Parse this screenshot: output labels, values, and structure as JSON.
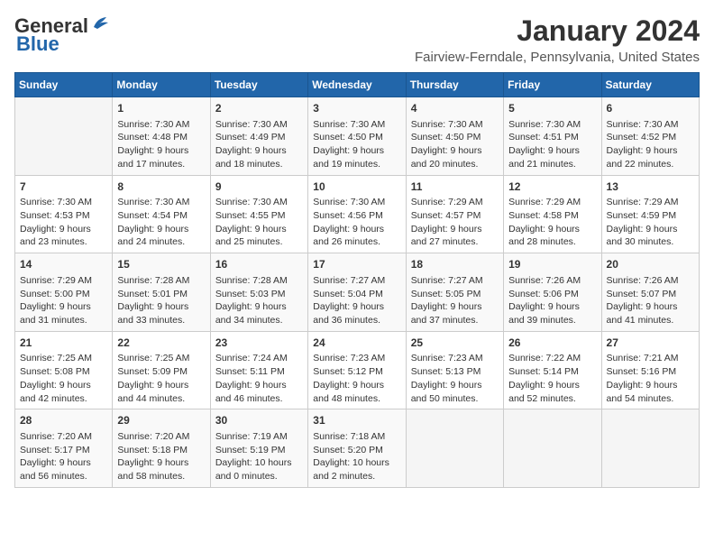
{
  "header": {
    "logo_general": "General",
    "logo_blue": "Blue",
    "month_title": "January 2024",
    "location": "Fairview-Ferndale, Pennsylvania, United States"
  },
  "weekdays": [
    "Sunday",
    "Monday",
    "Tuesday",
    "Wednesday",
    "Thursday",
    "Friday",
    "Saturday"
  ],
  "weeks": [
    [
      {
        "day": "",
        "sunrise": "",
        "sunset": "",
        "daylight": ""
      },
      {
        "day": "1",
        "sunrise": "Sunrise: 7:30 AM",
        "sunset": "Sunset: 4:48 PM",
        "daylight": "Daylight: 9 hours and 17 minutes."
      },
      {
        "day": "2",
        "sunrise": "Sunrise: 7:30 AM",
        "sunset": "Sunset: 4:49 PM",
        "daylight": "Daylight: 9 hours and 18 minutes."
      },
      {
        "day": "3",
        "sunrise": "Sunrise: 7:30 AM",
        "sunset": "Sunset: 4:50 PM",
        "daylight": "Daylight: 9 hours and 19 minutes."
      },
      {
        "day": "4",
        "sunrise": "Sunrise: 7:30 AM",
        "sunset": "Sunset: 4:50 PM",
        "daylight": "Daylight: 9 hours and 20 minutes."
      },
      {
        "day": "5",
        "sunrise": "Sunrise: 7:30 AM",
        "sunset": "Sunset: 4:51 PM",
        "daylight": "Daylight: 9 hours and 21 minutes."
      },
      {
        "day": "6",
        "sunrise": "Sunrise: 7:30 AM",
        "sunset": "Sunset: 4:52 PM",
        "daylight": "Daylight: 9 hours and 22 minutes."
      }
    ],
    [
      {
        "day": "7",
        "sunrise": "Sunrise: 7:30 AM",
        "sunset": "Sunset: 4:53 PM",
        "daylight": "Daylight: 9 hours and 23 minutes."
      },
      {
        "day": "8",
        "sunrise": "Sunrise: 7:30 AM",
        "sunset": "Sunset: 4:54 PM",
        "daylight": "Daylight: 9 hours and 24 minutes."
      },
      {
        "day": "9",
        "sunrise": "Sunrise: 7:30 AM",
        "sunset": "Sunset: 4:55 PM",
        "daylight": "Daylight: 9 hours and 25 minutes."
      },
      {
        "day": "10",
        "sunrise": "Sunrise: 7:30 AM",
        "sunset": "Sunset: 4:56 PM",
        "daylight": "Daylight: 9 hours and 26 minutes."
      },
      {
        "day": "11",
        "sunrise": "Sunrise: 7:29 AM",
        "sunset": "Sunset: 4:57 PM",
        "daylight": "Daylight: 9 hours and 27 minutes."
      },
      {
        "day": "12",
        "sunrise": "Sunrise: 7:29 AM",
        "sunset": "Sunset: 4:58 PM",
        "daylight": "Daylight: 9 hours and 28 minutes."
      },
      {
        "day": "13",
        "sunrise": "Sunrise: 7:29 AM",
        "sunset": "Sunset: 4:59 PM",
        "daylight": "Daylight: 9 hours and 30 minutes."
      }
    ],
    [
      {
        "day": "14",
        "sunrise": "Sunrise: 7:29 AM",
        "sunset": "Sunset: 5:00 PM",
        "daylight": "Daylight: 9 hours and 31 minutes."
      },
      {
        "day": "15",
        "sunrise": "Sunrise: 7:28 AM",
        "sunset": "Sunset: 5:01 PM",
        "daylight": "Daylight: 9 hours and 33 minutes."
      },
      {
        "day": "16",
        "sunrise": "Sunrise: 7:28 AM",
        "sunset": "Sunset: 5:03 PM",
        "daylight": "Daylight: 9 hours and 34 minutes."
      },
      {
        "day": "17",
        "sunrise": "Sunrise: 7:27 AM",
        "sunset": "Sunset: 5:04 PM",
        "daylight": "Daylight: 9 hours and 36 minutes."
      },
      {
        "day": "18",
        "sunrise": "Sunrise: 7:27 AM",
        "sunset": "Sunset: 5:05 PM",
        "daylight": "Daylight: 9 hours and 37 minutes."
      },
      {
        "day": "19",
        "sunrise": "Sunrise: 7:26 AM",
        "sunset": "Sunset: 5:06 PM",
        "daylight": "Daylight: 9 hours and 39 minutes."
      },
      {
        "day": "20",
        "sunrise": "Sunrise: 7:26 AM",
        "sunset": "Sunset: 5:07 PM",
        "daylight": "Daylight: 9 hours and 41 minutes."
      }
    ],
    [
      {
        "day": "21",
        "sunrise": "Sunrise: 7:25 AM",
        "sunset": "Sunset: 5:08 PM",
        "daylight": "Daylight: 9 hours and 42 minutes."
      },
      {
        "day": "22",
        "sunrise": "Sunrise: 7:25 AM",
        "sunset": "Sunset: 5:09 PM",
        "daylight": "Daylight: 9 hours and 44 minutes."
      },
      {
        "day": "23",
        "sunrise": "Sunrise: 7:24 AM",
        "sunset": "Sunset: 5:11 PM",
        "daylight": "Daylight: 9 hours and 46 minutes."
      },
      {
        "day": "24",
        "sunrise": "Sunrise: 7:23 AM",
        "sunset": "Sunset: 5:12 PM",
        "daylight": "Daylight: 9 hours and 48 minutes."
      },
      {
        "day": "25",
        "sunrise": "Sunrise: 7:23 AM",
        "sunset": "Sunset: 5:13 PM",
        "daylight": "Daylight: 9 hours and 50 minutes."
      },
      {
        "day": "26",
        "sunrise": "Sunrise: 7:22 AM",
        "sunset": "Sunset: 5:14 PM",
        "daylight": "Daylight: 9 hours and 52 minutes."
      },
      {
        "day": "27",
        "sunrise": "Sunrise: 7:21 AM",
        "sunset": "Sunset: 5:16 PM",
        "daylight": "Daylight: 9 hours and 54 minutes."
      }
    ],
    [
      {
        "day": "28",
        "sunrise": "Sunrise: 7:20 AM",
        "sunset": "Sunset: 5:17 PM",
        "daylight": "Daylight: 9 hours and 56 minutes."
      },
      {
        "day": "29",
        "sunrise": "Sunrise: 7:20 AM",
        "sunset": "Sunset: 5:18 PM",
        "daylight": "Daylight: 9 hours and 58 minutes."
      },
      {
        "day": "30",
        "sunrise": "Sunrise: 7:19 AM",
        "sunset": "Sunset: 5:19 PM",
        "daylight": "Daylight: 10 hours and 0 minutes."
      },
      {
        "day": "31",
        "sunrise": "Sunrise: 7:18 AM",
        "sunset": "Sunset: 5:20 PM",
        "daylight": "Daylight: 10 hours and 2 minutes."
      },
      {
        "day": "",
        "sunrise": "",
        "sunset": "",
        "daylight": ""
      },
      {
        "day": "",
        "sunrise": "",
        "sunset": "",
        "daylight": ""
      },
      {
        "day": "",
        "sunrise": "",
        "sunset": "",
        "daylight": ""
      }
    ]
  ]
}
